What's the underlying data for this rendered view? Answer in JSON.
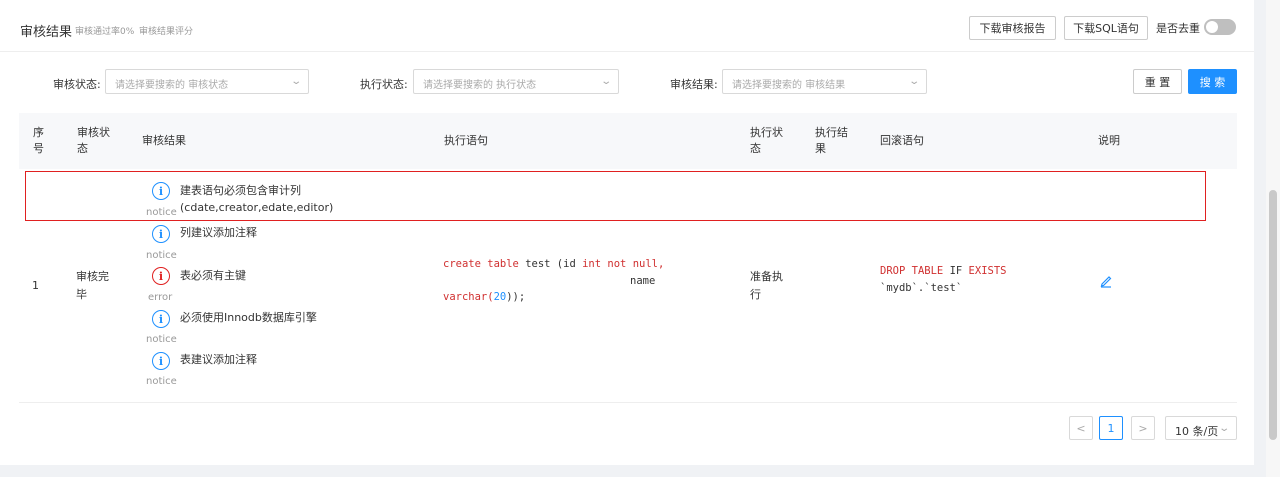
{
  "header": {
    "title": "审核结果",
    "pass_rate": "审核通过率0%",
    "score": "审核结果评分",
    "download_report": "下载审核报告",
    "download_sql": "下载SQL语句",
    "dedupe_label": "是否去重"
  },
  "filters": {
    "audit_status_label": "审核状态:",
    "audit_status_placeholder": "请选择要搜索的 审核状态",
    "exec_status_label": "执行状态:",
    "exec_status_placeholder": "请选择要搜索的 执行状态",
    "audit_result_label": "审核结果:",
    "audit_result_placeholder": "请选择要搜索的 审核结果",
    "reset": "重 置",
    "search": "搜 索"
  },
  "table": {
    "headers": {
      "index_1": "序",
      "index_2": "号",
      "audit_status_1": "审核状",
      "audit_status_2": "态",
      "audit_result": "审核结果",
      "statement": "执行语句",
      "exec_status_1": "执行状",
      "exec_status_2": "态",
      "exec_result_1": "执行结",
      "exec_result_2": "果",
      "rollback": "回滚语句",
      "description": "说明"
    },
    "row": {
      "index": "1",
      "audit_status_1": "审核完",
      "audit_status_2": "毕",
      "issues": [
        {
          "text_1": "建表语句必须包含审计列",
          "text_2": "(cdate,creator,edate,editor)",
          "level": "notice"
        },
        {
          "text_1": "列建议添加注释",
          "level": "notice"
        },
        {
          "text_1": "表必须有主键",
          "level": "error"
        },
        {
          "text_1": "必须使用Innodb数据库引擎",
          "level": "notice"
        },
        {
          "text_1": "表建议添加注释",
          "level": "notice"
        }
      ],
      "sql": {
        "create": "create",
        "table": "table",
        "name_test": "test (id",
        "int": "int",
        "not": "not",
        "null": "null,",
        "name_col": "name",
        "varchar": "varchar(",
        "twenty": "20",
        "close": "));"
      },
      "exec_status_1": "准备执",
      "exec_status_2": "行",
      "rollback": {
        "drop": "DROP",
        "table_kw": "TABLE",
        "if": "IF",
        "exists": "EXISTS",
        "target": "`mydb`.`test`"
      }
    }
  },
  "pagination": {
    "prev": "<",
    "page": "1",
    "next": ">",
    "page_size": "10 条/页"
  },
  "colors": {
    "primary": "#1e90ff",
    "error": "#e02020"
  }
}
